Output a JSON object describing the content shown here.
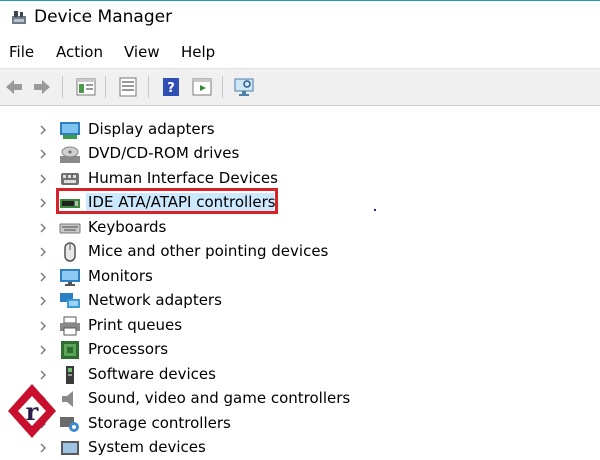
{
  "window": {
    "title": "Device Manager"
  },
  "menu": [
    {
      "label": "File"
    },
    {
      "label": "Action"
    },
    {
      "label": "View"
    },
    {
      "label": "Help"
    }
  ],
  "toolbar": {
    "buttons": [
      "back-icon",
      "forward-icon",
      "show-hide-console-tree-icon",
      "properties-icon",
      "help-icon",
      "run-icon",
      "scan-hardware-icon"
    ]
  },
  "tree": {
    "items": [
      {
        "label": "Display adapters",
        "icon": "display-adapter-icon"
      },
      {
        "label": "DVD/CD-ROM drives",
        "icon": "dvd-drive-icon"
      },
      {
        "label": "Human Interface Devices",
        "icon": "hid-icon"
      },
      {
        "label": "IDE ATA/ATAPI controllers",
        "icon": "ide-controller-icon",
        "selected": true
      },
      {
        "label": "Keyboards",
        "icon": "keyboard-icon"
      },
      {
        "label": "Mice and other pointing devices",
        "icon": "mouse-icon"
      },
      {
        "label": "Monitors",
        "icon": "monitor-icon"
      },
      {
        "label": "Network adapters",
        "icon": "network-adapter-icon"
      },
      {
        "label": "Print queues",
        "icon": "printer-icon"
      },
      {
        "label": "Processors",
        "icon": "processor-icon"
      },
      {
        "label": "Software devices",
        "icon": "software-device-icon"
      },
      {
        "label": "Sound, video and game controllers",
        "icon": "speaker-icon"
      },
      {
        "label": "Storage controllers",
        "icon": "storage-controller-icon"
      },
      {
        "label": "System devices",
        "icon": "system-device-icon"
      }
    ]
  },
  "colors": {
    "highlight_border": "#d4242a",
    "selection": "#cce8ff",
    "watermark": "#c8102e"
  }
}
